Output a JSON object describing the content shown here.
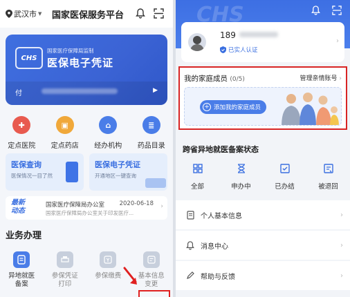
{
  "left": {
    "header": {
      "location": "武汉市",
      "title": "国家医保服务平台"
    },
    "card": {
      "logo": "CHS",
      "subtitle": "国家医疗保障局监制",
      "title": "医保电子凭证",
      "pay_label": "付"
    },
    "quick_actions": [
      {
        "label": "定点医院",
        "color": "#e85a4f",
        "icon": "hospital-icon"
      },
      {
        "label": "定点药店",
        "color": "#f0a83a",
        "icon": "pharmacy-icon"
      },
      {
        "label": "经办机构",
        "color": "#4a7de8",
        "icon": "agency-icon"
      },
      {
        "label": "药品目录",
        "color": "#4a7de8",
        "icon": "drug-catalog-icon"
      }
    ],
    "promos": [
      {
        "title": "医保查询",
        "subtitle": "医保情况一目了然"
      },
      {
        "title": "医保电子凭证",
        "subtitle": "开通地区一键查询"
      }
    ],
    "news": {
      "badge_line1": "最新",
      "badge_line2": "动态",
      "headline": "国家医疗保障局办公室",
      "date": "2020-06-18",
      "summary": "国家医疗保障局办公室关于印发医疗..."
    },
    "section_title": "业务办理",
    "services": [
      {
        "label": "异地就医备案",
        "label_line1": "异地就医",
        "label_line2": "备案",
        "active": true
      },
      {
        "label": "参保凭证打印",
        "label_line1": "参保凭证",
        "label_line2": "打印",
        "active": false
      },
      {
        "label": "参保缴费",
        "label_line1": "参保缴费",
        "label_line2": "",
        "active": false
      },
      {
        "label": "基本信息变更",
        "label_line1": "基本信息",
        "label_line2": "变更",
        "active": false
      }
    ]
  },
  "right": {
    "hero_watermark": "CHS",
    "profile": {
      "phone": "189",
      "verified": "已实人认证"
    },
    "family": {
      "title": "我的家庭成员",
      "count": "(0/5)",
      "manage": "管理亲情账号",
      "add_button": "添加我的家庭成员"
    },
    "cross_title": "跨省异地就医备案状态",
    "statuses": [
      {
        "label": "全部",
        "icon": "grid-icon"
      },
      {
        "label": "申办中",
        "icon": "hourglass-icon"
      },
      {
        "label": "已办结",
        "icon": "done-icon"
      },
      {
        "label": "被退回",
        "icon": "returned-icon"
      }
    ],
    "menu": [
      {
        "label": "个人基本信息",
        "icon": "profile-doc-icon"
      },
      {
        "label": "消息中心",
        "icon": "bell-icon"
      },
      {
        "label": "帮助与反馈",
        "icon": "pen-icon"
      }
    ]
  },
  "colors": {
    "primary": "#4a7de8",
    "highlight": "#d82424"
  }
}
